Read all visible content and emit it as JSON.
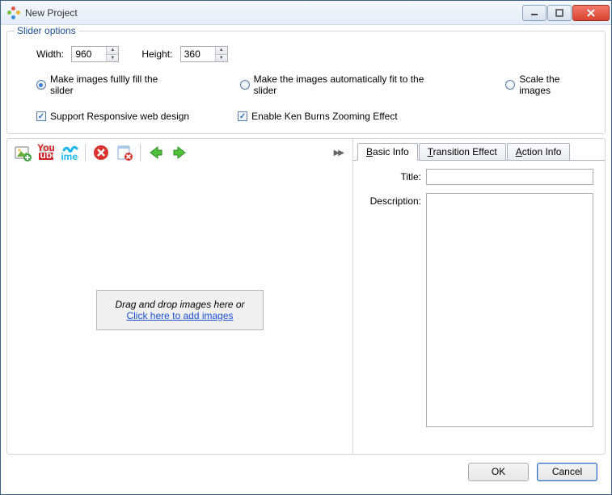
{
  "window": {
    "title": "New Project"
  },
  "slider": {
    "legend": "Slider options",
    "width_label": "Width:",
    "width_value": "960",
    "height_label": "Height:",
    "height_value": "360",
    "fill_label": "Make images fullly fill the silder",
    "auto_label": "Make the images automatically fit to the slider",
    "scale_label": "Scale the images",
    "responsive_label": "Support Responsive web design",
    "kenburns_label": "Enable Ken Burns Zooming Effect"
  },
  "dropzone": {
    "line1": "Drag and drop images here or",
    "link": "Click here to add images"
  },
  "tabs": {
    "basic": "Basic Info",
    "transition": "Transition Effect",
    "action": "Action Info"
  },
  "form": {
    "title_label": "Title:",
    "title_value": "",
    "desc_label": "Description:",
    "desc_value": ""
  },
  "buttons": {
    "ok": "OK",
    "cancel": "Cancel"
  },
  "icons": {
    "add_image": "add-image-icon",
    "youtube": "youtube-icon",
    "vimeo": "vimeo-icon",
    "delete": "delete-icon",
    "clear": "clear-list-icon",
    "left": "arrow-left-icon",
    "right": "arrow-right-icon"
  }
}
